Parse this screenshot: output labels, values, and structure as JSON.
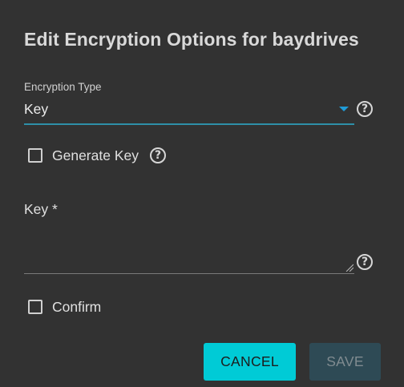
{
  "dialog": {
    "title": "Edit Encryption Options for baydrives"
  },
  "encryption_type": {
    "label": "Encryption Type",
    "value": "Key",
    "help_icon": "help-circle-icon"
  },
  "generate_key": {
    "label": "Generate Key",
    "checked": false,
    "help_icon": "help-circle-icon"
  },
  "key": {
    "label": "Key *",
    "value": "",
    "help_icon": "help-circle-icon"
  },
  "confirm": {
    "label": "Confirm",
    "checked": false
  },
  "buttons": {
    "cancel_label": "CANCEL",
    "save_label": "SAVE",
    "save_disabled": true
  },
  "colors": {
    "background": "#323232",
    "accent": "#00cbd6",
    "select_underline": "#2e8fa8",
    "dropdown_arrow": "#1f9bd7",
    "save_disabled_bg": "#2e4a55"
  }
}
